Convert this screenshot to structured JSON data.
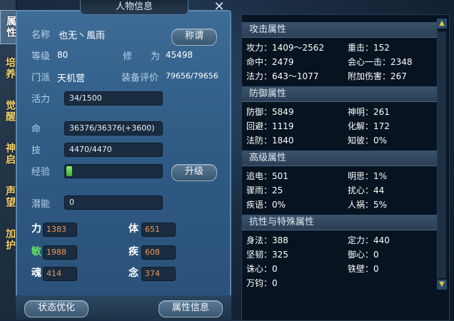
{
  "side_tabs": [
    "属性",
    "培养",
    "觉醒",
    "神启",
    "声望",
    "加护"
  ],
  "panel": {
    "title": "人物信息",
    "name_label": "名称",
    "name_value": "也无丶風雨",
    "title_button": "称谓",
    "level_label": "等级",
    "level_value": "80",
    "cultivation_label": "修　　为",
    "cultivation_value": "45498",
    "sect_label": "门派",
    "sect_value": "天机营",
    "equip_label": "装备评价",
    "equip_value": "79656/79656",
    "vitality_label": "活力",
    "vitality_value": "34/1500",
    "hp_label": "命",
    "hp_value": "36376/36376(+3600)",
    "skill_label": "技",
    "skill_value": "4470/4470",
    "exp_label": "经验",
    "exp_progress": 0.03,
    "upgrade_button": "升级",
    "potential_label": "潜能",
    "potential_value": "0",
    "stats": {
      "str_label": "力",
      "str_value": "1383",
      "con_label": "体",
      "con_value": "651",
      "agi_label": "敏",
      "agi_value": "1988",
      "spd_label": "疾",
      "spd_value": "608",
      "soul_label": "魂",
      "soul_value": "414",
      "mind_label": "念",
      "mind_value": "374"
    },
    "status_button": "状态优化",
    "attr_button": "属性信息"
  },
  "attrs": {
    "attack_title": "攻击属性",
    "attack_rows": [
      [
        "攻力：1409～2562",
        "重击：152"
      ],
      [
        "命中：2479",
        "会心一击：2348"
      ],
      [
        "法力：643～1077",
        "附加伤害：267"
      ]
    ],
    "defense_title": "防御属性",
    "defense_rows": [
      [
        "防御：5849",
        "神明：261"
      ],
      [
        "回避：1119",
        "化解：172"
      ],
      [
        "法防：1840",
        "知彼：0%"
      ]
    ],
    "advanced_title": "高级属性",
    "advanced_rows": [
      [
        "追电：501",
        "明思：1%"
      ],
      [
        "骤雨：25",
        "扰心：44"
      ],
      [
        "疾语：0%",
        "人祸：5%"
      ]
    ],
    "resist_title": "抗性与特殊属性",
    "resist_rows": [
      [
        "身法：388",
        "定力：440"
      ],
      [
        "坚韧：325",
        "御心：0"
      ],
      [
        "诛心：0",
        "铁壁：0"
      ],
      [
        "万钧：0",
        ""
      ]
    ]
  },
  "colors": {
    "panel_blue": "#3d6c96",
    "stat_value_orange": "#e89a5a",
    "agi_green": "#60e060",
    "tab_gold": "#f0d070"
  }
}
